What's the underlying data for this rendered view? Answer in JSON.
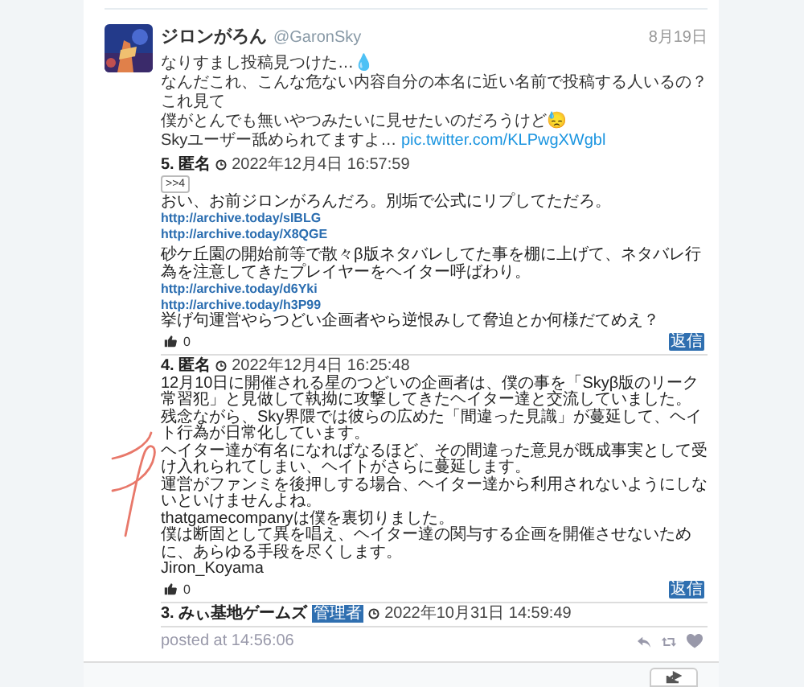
{
  "tweet": {
    "author_name": "ジロンがろん",
    "handle": "@GaronSky",
    "date": "8月19日",
    "text_lines": [
      "なりすまし投稿見つけた…💧",
      "なんだこれ、こんな危ない内容自分の本名に近い名前で投稿する人いるの？これ見て",
      "僕がとんでも無いやつみたいに見せたいのだろうけど😓",
      "Skyユーザー舐められてますよ…"
    ],
    "link": "pic.twitter.com/KLPwgXWgbl",
    "embedded": {
      "posts": [
        {
          "title": "5. 匿名",
          "timestamp": "2022年12月4日 16:57:59",
          "reply_ref": ">>4",
          "lines": [
            {
              "kind": "text",
              "text": "おい、お前ジロンがろんだろ。別垢で公式にリプしてただろ。"
            },
            {
              "kind": "link",
              "text": "http://archive.today/sIBLG"
            },
            {
              "kind": "link",
              "text": "http://archive.today/X8QGE"
            },
            {
              "kind": "gap"
            },
            {
              "kind": "text",
              "text": "砂ケ丘園の開始前等で散々β版ネタバレしてた事を棚に上げて、ネタバレ行為を注意してきたプレイヤーをヘイター呼ばわり。"
            },
            {
              "kind": "link",
              "text": "http://archive.today/d6Yki"
            },
            {
              "kind": "link",
              "text": "http://archive.today/h3P99"
            },
            {
              "kind": "text",
              "text": "挙げ句運営やらつどい企画者やら逆恨みして脅迫とか何様だてめえ？"
            }
          ],
          "likes": "0",
          "reply_button": "返信"
        },
        {
          "title": "4. 匿名",
          "timestamp": "2022年12月4日 16:25:48",
          "lines": [
            {
              "kind": "text",
              "text": "12月10日に開催される星のつどいの企画者は、僕の事を「Skyβ版のリーク常習犯」と見做して執拗に攻撃してきたヘイター達と交流していました。"
            },
            {
              "kind": "text",
              "text": "残念ながら、Sky界隈では彼らの広めた「間違った見識」が蔓延して、ヘイト行為が日常化しています。"
            },
            {
              "kind": "text",
              "text": "ヘイター達が有名になればなるほど、その間違った意見が既成事実として受け入れられてしまい、ヘイトがさらに蔓延します。"
            },
            {
              "kind": "text",
              "text": "運営がファンミを後押しする場合、ヘイター達から利用されないようにしないといけませんよね。"
            },
            {
              "kind": "text",
              "text": "thatgamecompanyは僕を裏切りました。"
            },
            {
              "kind": "text",
              "text": "僕は断固として異を唱え、ヘイター達の関与する企画を開催させないために、あらゆる手段を尽くします。"
            },
            {
              "kind": "text",
              "text": "Jiron_Koyama"
            }
          ],
          "likes": "0",
          "reply_button": "返信"
        },
        {
          "title": "3. みぃ基地ゲームズ",
          "badge": "管理者",
          "timestamp": "2022年10月31日 14:59:49"
        }
      ]
    },
    "posted_at": "posted at 14:56:06"
  }
}
